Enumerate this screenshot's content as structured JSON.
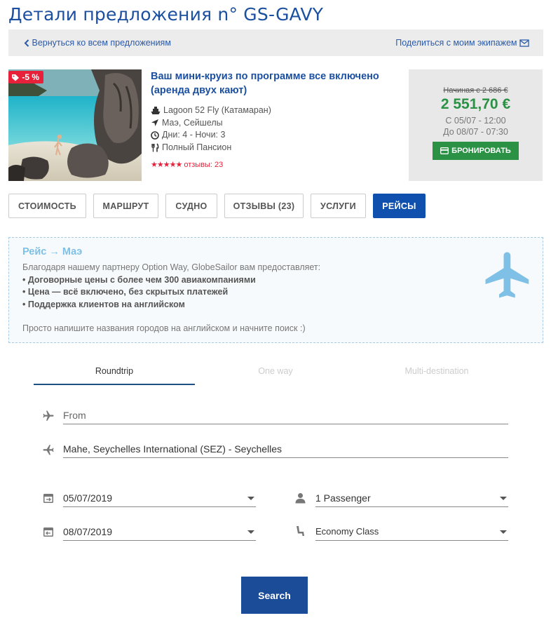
{
  "page": {
    "title": "Детали предложения n° GS-GAVY"
  },
  "nav": {
    "back_label": "Вернуться ко всем предложениям",
    "share_label": "Поделиться с моим экипажем"
  },
  "offer": {
    "discount": "-5 %",
    "title": "Ваш мини-круиз по программе все включено (аренда двух кают)",
    "boat": "Lagoon 52 Fly (Катамаран)",
    "location": "Маэ, Сейшелы",
    "duration": "Дни: 4 - Ночи: 3",
    "board": "Полный Пансион",
    "stars": "★★★★★",
    "reviews": "отзывы: 23",
    "rating_value": 5
  },
  "price": {
    "old": "Начиная с 2 686 €",
    "new": "2 551,70 €",
    "from": "С 05/07 - 12:00",
    "to": "До 08/07 - 07:30",
    "book_label": "БРОНИРОВАТЬ"
  },
  "tabs": [
    {
      "label": "СТОИМОСТЬ"
    },
    {
      "label": "МАРШРУТ"
    },
    {
      "label": "СУДНО"
    },
    {
      "label": "ОТЗЫВЫ (23)"
    },
    {
      "label": "УСЛУГИ"
    },
    {
      "label": "РЕЙСЫ"
    }
  ],
  "flights": {
    "title": "Рейс → Маэ",
    "intro": "Благодаря нашему партнеру Option Way, GlobeSailor вам предоставляет:",
    "bullets": [
      "• Договорные цены с более чем 300 авиакомпаниями",
      "• Цена — всё включено, без скрытых платежей",
      "• Поддержка клиентов на английском"
    ],
    "hint": "Просто напишите названия городов на английском и начните поиск :)"
  },
  "search_form": {
    "modes": [
      "Roundtrip",
      "One way",
      "Multi-destination"
    ],
    "from_placeholder": "From",
    "to_value": "Mahe, Seychelles International (SEZ) - Seychelles",
    "depart_date": "05/07/2019",
    "return_date": "08/07/2019",
    "passengers": "1 Passenger",
    "cabin_class": "Economy Class",
    "search_label": "Search"
  },
  "colors": {
    "brand_blue": "#1b4fa0",
    "price_green": "#2a9145",
    "discount_red": "#e8213b",
    "active_tab": "#0f4fae",
    "plane_light_blue": "#7ec0e6"
  }
}
